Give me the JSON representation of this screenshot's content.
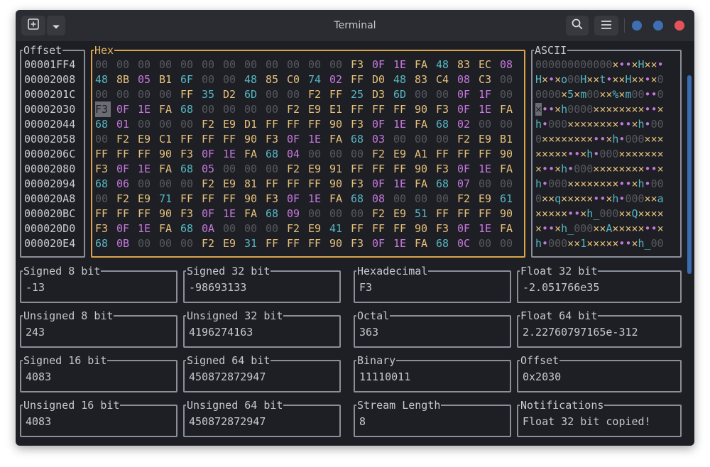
{
  "window": {
    "title": "Terminal"
  },
  "titlebar": {
    "new_tab_icon": "plus-square-icon",
    "dropdown_icon": "chevron-down-icon",
    "search_icon": "search-icon",
    "menu_icon": "hamburger-menu-icon",
    "dot_colors": [
      "#3e6fb2",
      "#3e6fb2",
      "#e5535a"
    ]
  },
  "panels": {
    "offset_label": "Offset",
    "hex_label": "Hex",
    "ascii_label": "ASCII"
  },
  "rows": [
    {
      "offset": "00001FF4",
      "bytes": [
        "00",
        "00",
        "00",
        "00",
        "00",
        "00",
        "00",
        "00",
        "00",
        "00",
        "00",
        "00",
        "F3",
        "0F",
        "1E",
        "FA",
        "48",
        "83",
        "EC",
        "08"
      ],
      "ascii": "000000000000×••×H××•"
    },
    {
      "offset": "00002008",
      "bytes": [
        "48",
        "8B",
        "05",
        "B1",
        "6F",
        "00",
        "00",
        "48",
        "85",
        "C0",
        "74",
        "02",
        "FF",
        "D0",
        "48",
        "83",
        "C4",
        "08",
        "C3",
        "00"
      ],
      "ascii": "H×•×o00H××t•××H××•×0"
    },
    {
      "offset": "0000201C",
      "bytes": [
        "00",
        "00",
        "00",
        "00",
        "FF",
        "35",
        "D2",
        "6D",
        "00",
        "00",
        "F2",
        "FF",
        "25",
        "D3",
        "6D",
        "00",
        "00",
        "0F",
        "1F",
        "00"
      ],
      "ascii": "0000×5×m00××%×m00••0"
    },
    {
      "offset": "00002030",
      "bytes": [
        "F3",
        "0F",
        "1E",
        "FA",
        "68",
        "00",
        "00",
        "00",
        "00",
        "F2",
        "E9",
        "E1",
        "FF",
        "FF",
        "FF",
        "90",
        "F3",
        "0F",
        "1E",
        "FA"
      ],
      "ascii": "×••×h0000××××××××••×"
    },
    {
      "offset": "00002044",
      "bytes": [
        "68",
        "01",
        "00",
        "00",
        "00",
        "F2",
        "E9",
        "D1",
        "FF",
        "FF",
        "FF",
        "90",
        "F3",
        "0F",
        "1E",
        "FA",
        "68",
        "02",
        "00",
        "00"
      ],
      "ascii": "h•000××××××××••×h•00"
    },
    {
      "offset": "00002058",
      "bytes": [
        "00",
        "F2",
        "E9",
        "C1",
        "FF",
        "FF",
        "FF",
        "90",
        "F3",
        "0F",
        "1E",
        "FA",
        "68",
        "03",
        "00",
        "00",
        "00",
        "F2",
        "E9",
        "B1"
      ],
      "ascii": "0××××××××••×h•000×××"
    },
    {
      "offset": "0000206C",
      "bytes": [
        "FF",
        "FF",
        "FF",
        "90",
        "F3",
        "0F",
        "1E",
        "FA",
        "68",
        "04",
        "00",
        "00",
        "00",
        "F2",
        "E9",
        "A1",
        "FF",
        "FF",
        "FF",
        "90"
      ],
      "ascii": "×××××••×h•000×××××××"
    },
    {
      "offset": "00002080",
      "bytes": [
        "F3",
        "0F",
        "1E",
        "FA",
        "68",
        "05",
        "00",
        "00",
        "00",
        "F2",
        "E9",
        "91",
        "FF",
        "FF",
        "FF",
        "90",
        "F3",
        "0F",
        "1E",
        "FA"
      ],
      "ascii": "×••×h•000××××××××••×"
    },
    {
      "offset": "00002094",
      "bytes": [
        "68",
        "06",
        "00",
        "00",
        "00",
        "F2",
        "E9",
        "81",
        "FF",
        "FF",
        "FF",
        "90",
        "F3",
        "0F",
        "1E",
        "FA",
        "68",
        "07",
        "00",
        "00"
      ],
      "ascii": "h•000××××××××••×h•00"
    },
    {
      "offset": "000020A8",
      "bytes": [
        "00",
        "F2",
        "E9",
        "71",
        "FF",
        "FF",
        "FF",
        "90",
        "F3",
        "0F",
        "1E",
        "FA",
        "68",
        "08",
        "00",
        "00",
        "00",
        "F2",
        "E9",
        "61"
      ],
      "ascii": "0××q×××××••×h•000××a"
    },
    {
      "offset": "000020BC",
      "bytes": [
        "FF",
        "FF",
        "FF",
        "90",
        "F3",
        "0F",
        "1E",
        "FA",
        "68",
        "09",
        "00",
        "00",
        "00",
        "F2",
        "E9",
        "51",
        "FF",
        "FF",
        "FF",
        "90"
      ],
      "ascii": "×××××••×h_000××Q××××"
    },
    {
      "offset": "000020D0",
      "bytes": [
        "F3",
        "0F",
        "1E",
        "FA",
        "68",
        "0A",
        "00",
        "00",
        "00",
        "F2",
        "E9",
        "41",
        "FF",
        "FF",
        "FF",
        "90",
        "F3",
        "0F",
        "1E",
        "FA"
      ],
      "ascii": "×••×h_000××A×××××••×"
    },
    {
      "offset": "000020E4",
      "bytes": [
        "68",
        "0B",
        "00",
        "00",
        "00",
        "F2",
        "E9",
        "31",
        "FF",
        "FF",
        "FF",
        "90",
        "F3",
        "0F",
        "1E",
        "FA",
        "68",
        "0C",
        "00",
        "00"
      ],
      "ascii": "h•000××1×××××••×h_00"
    }
  ],
  "selection": {
    "row": 3,
    "col": 0
  },
  "fields": [
    {
      "label": "Signed 8 bit",
      "value": "-13"
    },
    {
      "label": "Signed 32 bit",
      "value": "-98693133"
    },
    {
      "label": "Hexadecimal",
      "value": "F3"
    },
    {
      "label": "Float 32 bit",
      "value": "-2.051766e35"
    },
    {
      "label": "Unsigned 8 bit",
      "value": "243"
    },
    {
      "label": "Unsigned 32 bit",
      "value": "4196274163"
    },
    {
      "label": "Octal",
      "value": "363"
    },
    {
      "label": "Float 64 bit",
      "value": "2.22760797165e-312"
    },
    {
      "label": "Signed 16 bit",
      "value": "4083"
    },
    {
      "label": "Signed 64 bit",
      "value": "450872872947"
    },
    {
      "label": "Binary",
      "value": "11110011"
    },
    {
      "label": "Offset",
      "value": "0x2030"
    },
    {
      "label": "Unsigned 16 bit",
      "value": "4083"
    },
    {
      "label": "Unsigned 64 bit",
      "value": "450872872947"
    },
    {
      "label": "Stream Length",
      "value": "8"
    },
    {
      "label": "Notifications",
      "value": "Float 32 bit copied!"
    }
  ]
}
